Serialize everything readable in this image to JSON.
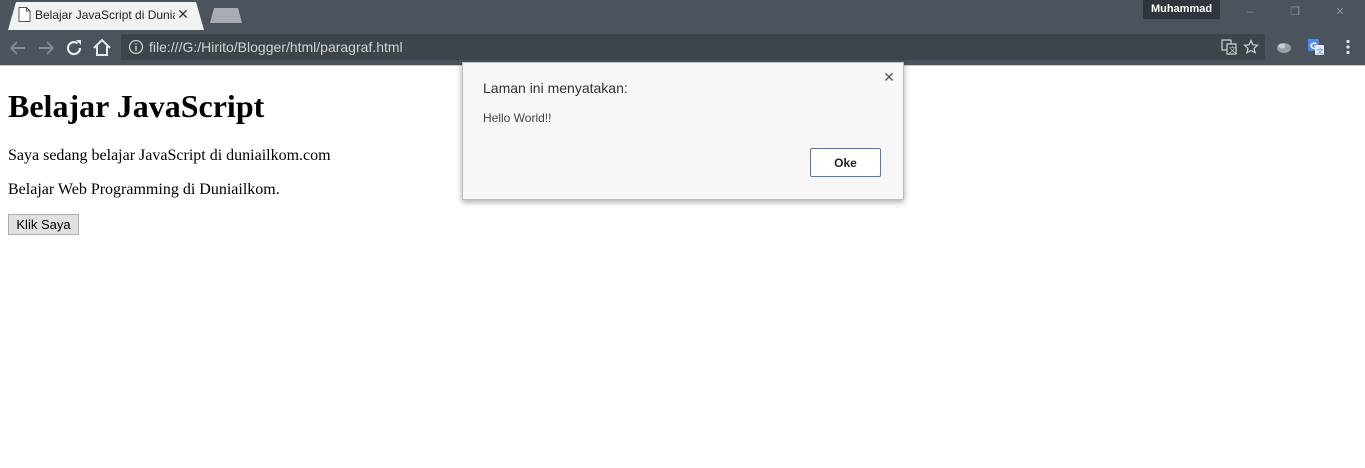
{
  "browser": {
    "tab": {
      "title": "Belajar JavaScript di Dunia",
      "close_glyph": "✕"
    },
    "profile_name": "Muhammad",
    "window_controls": {
      "minimize": "–",
      "restore": "❐",
      "close": "✕"
    },
    "address_bar": {
      "url": "file:///G:/Hirito/Blogger/html/paragraf.html"
    },
    "icons": {
      "back": "back-arrow-icon",
      "forward": "forward-arrow-icon",
      "reload": "reload-icon",
      "home": "home-icon",
      "info": "info-icon",
      "translate": "translate-icon",
      "bookmark": "star-icon",
      "extension": "extension-icon",
      "google_translate": "google-translate-icon",
      "menu": "kebab-menu-icon"
    },
    "colors": {
      "chrome": "#4b545c",
      "omnibox": "#3d444a",
      "tab_active": "#f2f2f2"
    }
  },
  "page": {
    "heading": "Belajar JavaScript",
    "paragraphs": [
      "Saya sedang belajar JavaScript di duniailkom.com",
      "Belajar Web Programming di Duniailkom."
    ],
    "button_label": "Klik Saya"
  },
  "alert": {
    "title": "Laman ini menyatakan:",
    "message": "Hello World!!",
    "ok_label": "Oke",
    "close_glyph": "✕",
    "colors": {
      "ok_border": "#4d78c9"
    }
  }
}
